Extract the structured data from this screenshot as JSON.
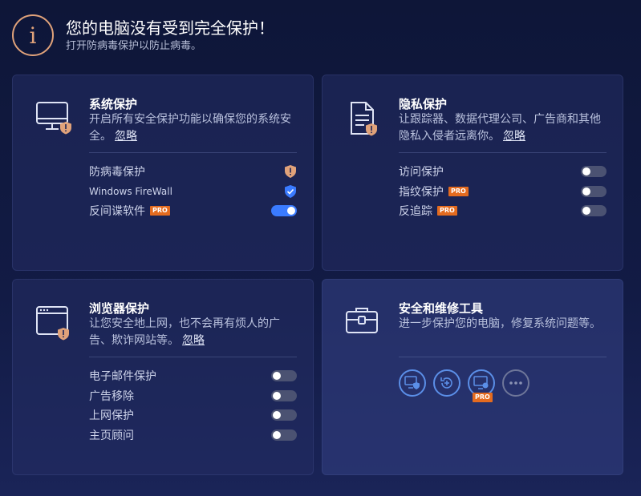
{
  "header": {
    "title": "您的电脑没有受到完全保护！",
    "subtitle": "打开防病毒保护以防止病毒。",
    "icon": "info-icon"
  },
  "colors": {
    "warning": "#e0a27a",
    "toggle_on": "#3a7bff",
    "pro_badge": "#e46b1f",
    "shield_blue": "#3a7bff",
    "tool_ring": "#5b8fe8"
  },
  "cards": {
    "system": {
      "title": "系统保护",
      "desc": "开启所有安全保护功能以确保您的系统安全。",
      "ignore": "忽略",
      "icon": "monitor-warning-icon",
      "rows": [
        {
          "label": "防病毒保护",
          "status": "warning"
        },
        {
          "label": "Windows FireWall",
          "status": "protected"
        },
        {
          "label": "反间谍软件",
          "pro": "PRO",
          "toggle": "on"
        }
      ]
    },
    "privacy": {
      "title": "隐私保护",
      "desc": "让跟踪器、数据代理公司、广告商和其他隐私入侵者远离你。",
      "ignore": "忽略",
      "icon": "document-warning-icon",
      "rows": [
        {
          "label": "访问保护",
          "toggle": "off"
        },
        {
          "label": "指纹保护",
          "pro": "PRO",
          "toggle": "off"
        },
        {
          "label": "反追踪",
          "pro": "PRO",
          "toggle": "off"
        }
      ]
    },
    "browser": {
      "title": "浏览器保护",
      "desc": "让您安全地上网，也不会再有烦人的广告、欺诈网站等。",
      "ignore": "忽略",
      "icon": "browser-warning-icon",
      "rows": [
        {
          "label": "电子邮件保护",
          "toggle": "off"
        },
        {
          "label": "广告移除",
          "toggle": "off"
        },
        {
          "label": "上网保护",
          "toggle": "off"
        },
        {
          "label": "主页顾问",
          "toggle": "off"
        }
      ]
    },
    "tools": {
      "title": "安全和维修工具",
      "desc": "进一步保护您的电脑，修复系统问题等。",
      "icon": "toolbox-icon",
      "items": [
        {
          "icon": "pc-shield-tool-icon"
        },
        {
          "icon": "restore-tool-icon"
        },
        {
          "icon": "pc-repair-tool-icon",
          "pro": "PRO"
        },
        {
          "icon": "more-icon"
        }
      ]
    }
  }
}
